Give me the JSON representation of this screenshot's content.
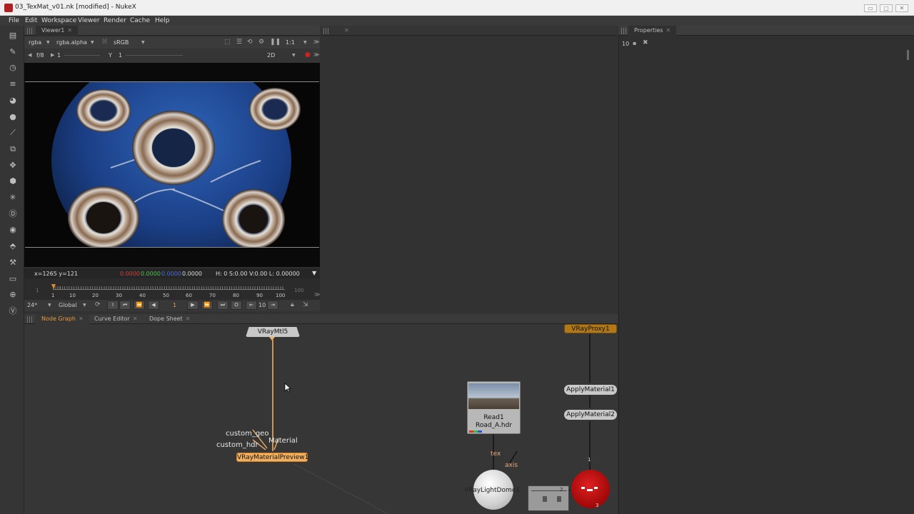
{
  "window": {
    "title": "03_TexMat_v01.nk [modified] - NukeX",
    "buttons": [
      "▭",
      "▢",
      "✕"
    ]
  },
  "menu": [
    "File",
    "Edit",
    "Workspace",
    "Viewer",
    "Render",
    "Cache",
    "Help"
  ],
  "toolbar_icons": [
    "image-icon",
    "draw-icon",
    "time-icon",
    "channel-icon",
    "color-icon",
    "filter-icon",
    "keyer-icon",
    "merge-icon",
    "transform-icon",
    "3d-icon",
    "particles-icon",
    "deep-icon",
    "views-icon",
    "metadata-icon",
    "toolsets-icon",
    "other-icon",
    "furnace-icon",
    "vray-icon"
  ],
  "viewer": {
    "tab": "Viewer1",
    "channels": "rgba",
    "alpha": "rgba.alpha",
    "colorspace": "sRGB",
    "zoom": "1:1",
    "fstop": "f/8",
    "gain": "1",
    "gamma_label": "Y",
    "gamma": "1",
    "view_mode": "2D",
    "coords": "x=1265 y=121",
    "pixel_r": "0.0000",
    "pixel_g": "0.0000",
    "pixel_b": "0.0000",
    "pixel_a": "0.0000",
    "hsv": "H:  0 S:0.00 V:0.00  L: 0.00000"
  },
  "timeline": {
    "start": "1",
    "end": "100",
    "ticks": [
      "1",
      "10",
      "20",
      "30",
      "40",
      "50",
      "60",
      "70",
      "80",
      "90",
      "100"
    ],
    "current_frame": "1",
    "fps": "24*",
    "scope": "Global",
    "step": "10",
    "left_bound": "1"
  },
  "properties": {
    "tab": "Properties",
    "max_panels": "10"
  },
  "bottom_tabs": [
    "Node Graph",
    "Curve Editor",
    "Dope Sheet"
  ],
  "nodes": {
    "vraymtl": "VRayMtl5",
    "preview": "VRayMaterialPreview1",
    "input_geo": "custom_geo",
    "input_hdr": "custom_hdr",
    "input_mat": "Material",
    "read_name": "Read1",
    "read_file": "Road_A.hdr",
    "tex_label": "tex",
    "axis_label": "axis",
    "lightdome": "VRayLightDome1",
    "proxy": "VRayProxy1",
    "apply1": "ApplyMaterial1",
    "apply2": "ApplyMaterial2",
    "pipe_num1": "1",
    "pipe_num2": "2",
    "pipe_num3": "3"
  },
  "colors": {
    "selected_node": "#f0b060",
    "proxy_node": "#b07818",
    "accent_tab": "#e89a3c",
    "red_node": "#c81616"
  }
}
